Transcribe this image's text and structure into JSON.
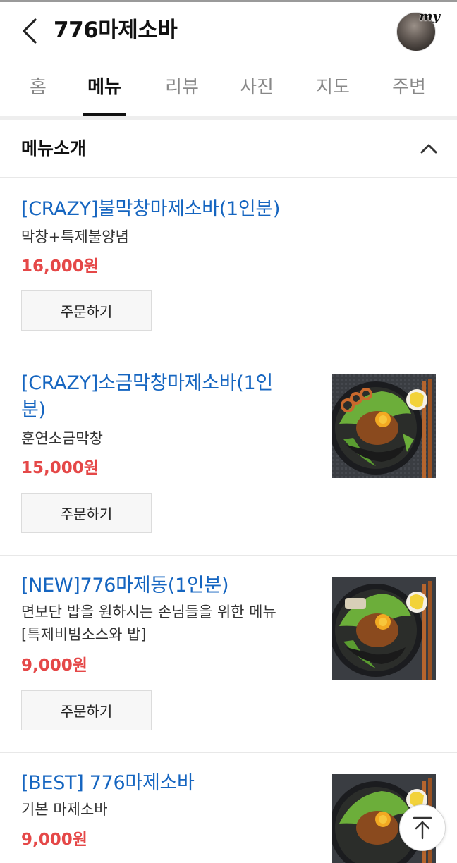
{
  "header": {
    "title": "776마제소바",
    "avatar_badge": "my"
  },
  "tabs": [
    {
      "label": "홈",
      "active": false
    },
    {
      "label": "메뉴",
      "active": true
    },
    {
      "label": "리뷰",
      "active": false
    },
    {
      "label": "사진",
      "active": false
    },
    {
      "label": "지도",
      "active": false
    },
    {
      "label": "주변",
      "active": false
    }
  ],
  "section": {
    "title": "메뉴소개"
  },
  "menu_items": [
    {
      "name": "[CRAZY]불막창마제소바(1인분)",
      "desc": "막창+특제불양념",
      "price": "16,000원",
      "order_label": "주문하기"
    },
    {
      "name_line1": "[CRAZY]소금막창마제소바(1인",
      "name_line2": "분)",
      "desc": "훈연소금막창",
      "price": "15,000원",
      "order_label": "주문하기"
    },
    {
      "name": "[NEW]776마제동(1인분)",
      "desc_line1": "면보단 밥을 원하시는 손님들을 위한 메뉴",
      "desc_line2": "[특제비빔소스와 밥]",
      "price": "9,000원",
      "order_label": "주문하기"
    },
    {
      "name": "[BEST] 776마제소바",
      "desc": "기본 마제소바",
      "price": "9,000원"
    }
  ],
  "colors": {
    "menu_name": "#1565c0",
    "price": "#e54848",
    "tab_active": "#111111",
    "tab_inactive": "#888888"
  },
  "icons": {
    "back": "chevron-left-icon",
    "collapse": "chevron-up-icon",
    "scroll_top": "arrow-up-to-top-icon"
  }
}
